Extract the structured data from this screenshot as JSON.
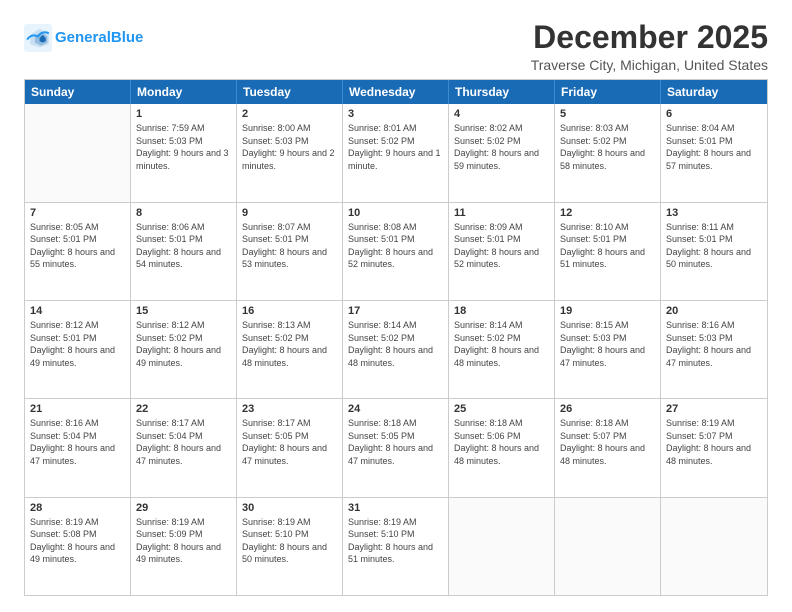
{
  "header": {
    "logo_line1": "General",
    "logo_line2": "Blue",
    "month_title": "December 2025",
    "subtitle": "Traverse City, Michigan, United States"
  },
  "weekdays": [
    "Sunday",
    "Monday",
    "Tuesday",
    "Wednesday",
    "Thursday",
    "Friday",
    "Saturday"
  ],
  "rows": [
    [
      {
        "day": "",
        "sunrise": "",
        "sunset": "",
        "daylight": ""
      },
      {
        "day": "1",
        "sunrise": "Sunrise: 7:59 AM",
        "sunset": "Sunset: 5:03 PM",
        "daylight": "Daylight: 9 hours and 3 minutes."
      },
      {
        "day": "2",
        "sunrise": "Sunrise: 8:00 AM",
        "sunset": "Sunset: 5:03 PM",
        "daylight": "Daylight: 9 hours and 2 minutes."
      },
      {
        "day": "3",
        "sunrise": "Sunrise: 8:01 AM",
        "sunset": "Sunset: 5:02 PM",
        "daylight": "Daylight: 9 hours and 1 minute."
      },
      {
        "day": "4",
        "sunrise": "Sunrise: 8:02 AM",
        "sunset": "Sunset: 5:02 PM",
        "daylight": "Daylight: 8 hours and 59 minutes."
      },
      {
        "day": "5",
        "sunrise": "Sunrise: 8:03 AM",
        "sunset": "Sunset: 5:02 PM",
        "daylight": "Daylight: 8 hours and 58 minutes."
      },
      {
        "day": "6",
        "sunrise": "Sunrise: 8:04 AM",
        "sunset": "Sunset: 5:01 PM",
        "daylight": "Daylight: 8 hours and 57 minutes."
      }
    ],
    [
      {
        "day": "7",
        "sunrise": "Sunrise: 8:05 AM",
        "sunset": "Sunset: 5:01 PM",
        "daylight": "Daylight: 8 hours and 55 minutes."
      },
      {
        "day": "8",
        "sunrise": "Sunrise: 8:06 AM",
        "sunset": "Sunset: 5:01 PM",
        "daylight": "Daylight: 8 hours and 54 minutes."
      },
      {
        "day": "9",
        "sunrise": "Sunrise: 8:07 AM",
        "sunset": "Sunset: 5:01 PM",
        "daylight": "Daylight: 8 hours and 53 minutes."
      },
      {
        "day": "10",
        "sunrise": "Sunrise: 8:08 AM",
        "sunset": "Sunset: 5:01 PM",
        "daylight": "Daylight: 8 hours and 52 minutes."
      },
      {
        "day": "11",
        "sunrise": "Sunrise: 8:09 AM",
        "sunset": "Sunset: 5:01 PM",
        "daylight": "Daylight: 8 hours and 52 minutes."
      },
      {
        "day": "12",
        "sunrise": "Sunrise: 8:10 AM",
        "sunset": "Sunset: 5:01 PM",
        "daylight": "Daylight: 8 hours and 51 minutes."
      },
      {
        "day": "13",
        "sunrise": "Sunrise: 8:11 AM",
        "sunset": "Sunset: 5:01 PM",
        "daylight": "Daylight: 8 hours and 50 minutes."
      }
    ],
    [
      {
        "day": "14",
        "sunrise": "Sunrise: 8:12 AM",
        "sunset": "Sunset: 5:01 PM",
        "daylight": "Daylight: 8 hours and 49 minutes."
      },
      {
        "day": "15",
        "sunrise": "Sunrise: 8:12 AM",
        "sunset": "Sunset: 5:02 PM",
        "daylight": "Daylight: 8 hours and 49 minutes."
      },
      {
        "day": "16",
        "sunrise": "Sunrise: 8:13 AM",
        "sunset": "Sunset: 5:02 PM",
        "daylight": "Daylight: 8 hours and 48 minutes."
      },
      {
        "day": "17",
        "sunrise": "Sunrise: 8:14 AM",
        "sunset": "Sunset: 5:02 PM",
        "daylight": "Daylight: 8 hours and 48 minutes."
      },
      {
        "day": "18",
        "sunrise": "Sunrise: 8:14 AM",
        "sunset": "Sunset: 5:02 PM",
        "daylight": "Daylight: 8 hours and 48 minutes."
      },
      {
        "day": "19",
        "sunrise": "Sunrise: 8:15 AM",
        "sunset": "Sunset: 5:03 PM",
        "daylight": "Daylight: 8 hours and 47 minutes."
      },
      {
        "day": "20",
        "sunrise": "Sunrise: 8:16 AM",
        "sunset": "Sunset: 5:03 PM",
        "daylight": "Daylight: 8 hours and 47 minutes."
      }
    ],
    [
      {
        "day": "21",
        "sunrise": "Sunrise: 8:16 AM",
        "sunset": "Sunset: 5:04 PM",
        "daylight": "Daylight: 8 hours and 47 minutes."
      },
      {
        "day": "22",
        "sunrise": "Sunrise: 8:17 AM",
        "sunset": "Sunset: 5:04 PM",
        "daylight": "Daylight: 8 hours and 47 minutes."
      },
      {
        "day": "23",
        "sunrise": "Sunrise: 8:17 AM",
        "sunset": "Sunset: 5:05 PM",
        "daylight": "Daylight: 8 hours and 47 minutes."
      },
      {
        "day": "24",
        "sunrise": "Sunrise: 8:18 AM",
        "sunset": "Sunset: 5:05 PM",
        "daylight": "Daylight: 8 hours and 47 minutes."
      },
      {
        "day": "25",
        "sunrise": "Sunrise: 8:18 AM",
        "sunset": "Sunset: 5:06 PM",
        "daylight": "Daylight: 8 hours and 48 minutes."
      },
      {
        "day": "26",
        "sunrise": "Sunrise: 8:18 AM",
        "sunset": "Sunset: 5:07 PM",
        "daylight": "Daylight: 8 hours and 48 minutes."
      },
      {
        "day": "27",
        "sunrise": "Sunrise: 8:19 AM",
        "sunset": "Sunset: 5:07 PM",
        "daylight": "Daylight: 8 hours and 48 minutes."
      }
    ],
    [
      {
        "day": "28",
        "sunrise": "Sunrise: 8:19 AM",
        "sunset": "Sunset: 5:08 PM",
        "daylight": "Daylight: 8 hours and 49 minutes."
      },
      {
        "day": "29",
        "sunrise": "Sunrise: 8:19 AM",
        "sunset": "Sunset: 5:09 PM",
        "daylight": "Daylight: 8 hours and 49 minutes."
      },
      {
        "day": "30",
        "sunrise": "Sunrise: 8:19 AM",
        "sunset": "Sunset: 5:10 PM",
        "daylight": "Daylight: 8 hours and 50 minutes."
      },
      {
        "day": "31",
        "sunrise": "Sunrise: 8:19 AM",
        "sunset": "Sunset: 5:10 PM",
        "daylight": "Daylight: 8 hours and 51 minutes."
      },
      {
        "day": "",
        "sunrise": "",
        "sunset": "",
        "daylight": ""
      },
      {
        "day": "",
        "sunrise": "",
        "sunset": "",
        "daylight": ""
      },
      {
        "day": "",
        "sunrise": "",
        "sunset": "",
        "daylight": ""
      }
    ]
  ]
}
